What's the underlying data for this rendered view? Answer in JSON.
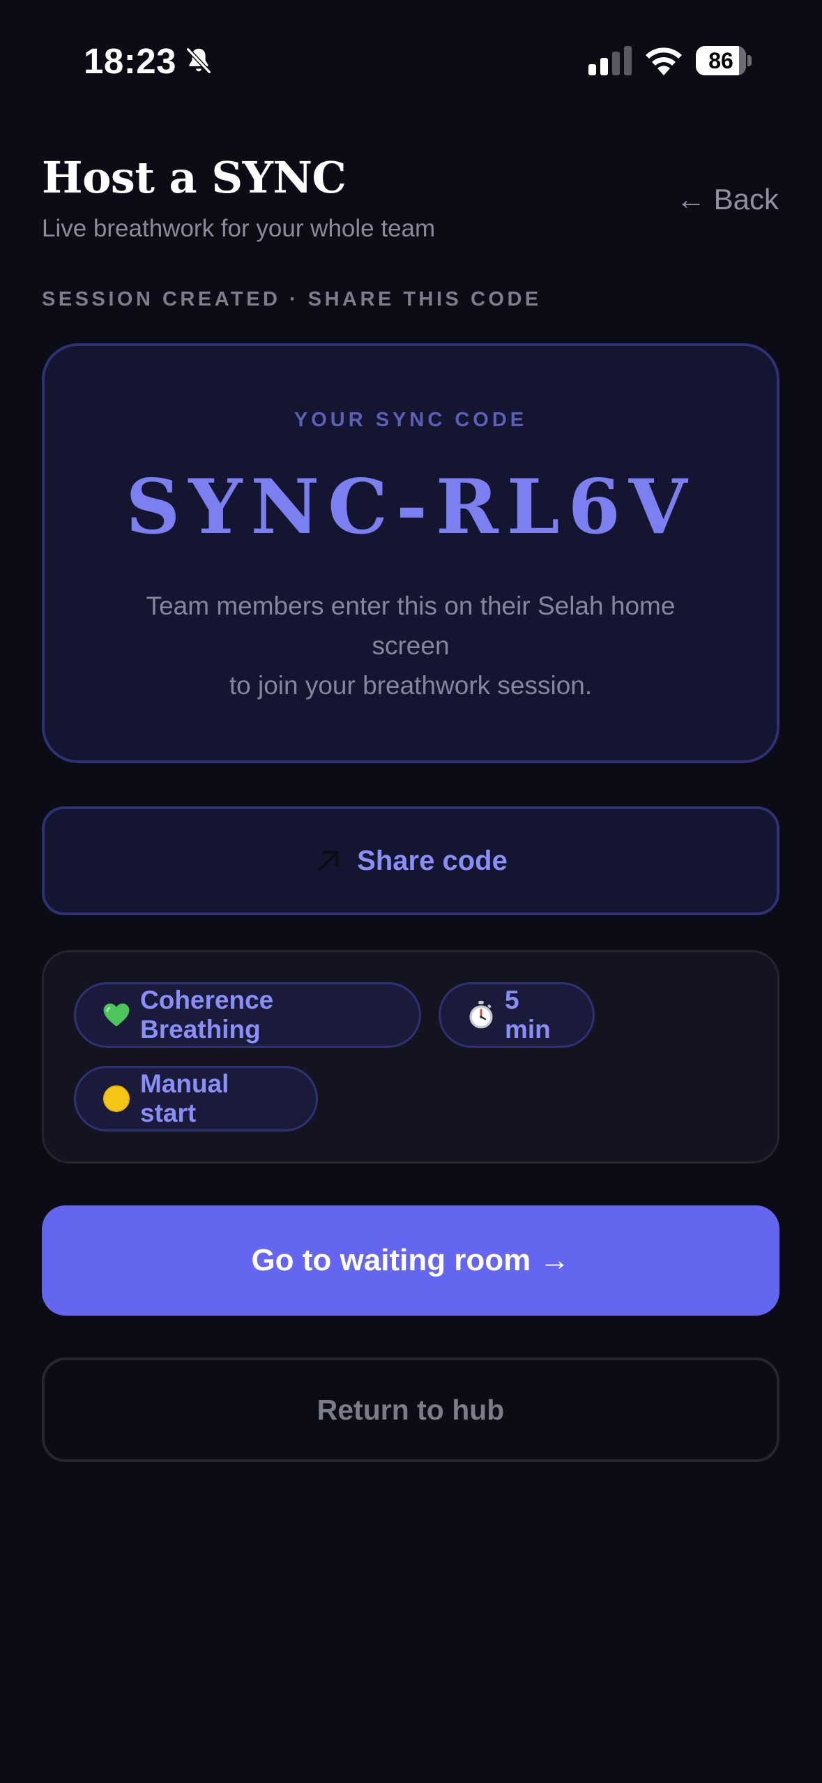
{
  "status_bar": {
    "time": "18:23",
    "battery_level": "86",
    "battery_fraction": 0.86,
    "icons": [
      "bell-off-icon",
      "signal-icon",
      "wifi-icon",
      "battery-icon"
    ]
  },
  "header": {
    "title": "Host a SYNC",
    "subtitle": "Live breathwork for your whole team",
    "back_label": "← Back"
  },
  "section_label": "SESSION CREATED · SHARE THIS CODE",
  "code_card": {
    "label": "YOUR SYNC CODE",
    "code": "SYNC-RL6V",
    "help_line1": "Team members enter this on their Selah home screen",
    "help_line2": "to join your breathwork session."
  },
  "share": {
    "label": "Share code",
    "icon": "arrow-up-right-icon"
  },
  "session_options": {
    "technique": {
      "icon": "green-heart-icon",
      "label": "Coherence Breathing"
    },
    "duration": {
      "icon": "stopwatch-icon",
      "label": "5 min"
    },
    "start_mode": {
      "icon": "yellow-circle-icon",
      "label": "Manual start"
    }
  },
  "actions": {
    "primary_label": "Go to waiting room →",
    "secondary_label": "Return to hub"
  },
  "colors": {
    "background": "#0b0c16",
    "accent": "#6466ef",
    "code_text": "#7b7ff0",
    "card_border": "#2f3174"
  }
}
